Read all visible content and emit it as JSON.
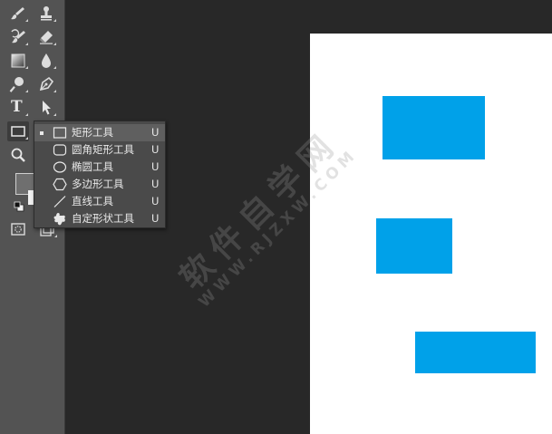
{
  "toolbar": {
    "tools": [
      {
        "id": "brush",
        "icon": "brush-icon"
      },
      {
        "id": "stamp",
        "icon": "stamp-icon"
      },
      {
        "id": "history-brush",
        "icon": "history-brush-icon"
      },
      {
        "id": "eraser",
        "icon": "eraser-icon"
      },
      {
        "id": "gradient",
        "icon": "gradient-icon"
      },
      {
        "id": "blur",
        "icon": "drop-icon"
      },
      {
        "id": "dodge",
        "icon": "dodge-icon"
      },
      {
        "id": "pen",
        "icon": "pen-icon"
      },
      {
        "id": "type",
        "icon": "type-icon",
        "glyph": "T"
      },
      {
        "id": "path-selection",
        "icon": "arrow-icon"
      },
      {
        "id": "rectangle",
        "icon": "rectangle-icon",
        "active": true
      },
      {
        "id": "zoom",
        "icon": "zoom-icon"
      },
      {
        "id": "quick-mask",
        "icon": "quick-mask-icon"
      },
      {
        "id": "screen-mode",
        "icon": "screen-mode-icon"
      }
    ],
    "colors": {
      "foreground": "#6f6f6f",
      "background": "#f2f2f2"
    }
  },
  "shape_menu": {
    "items": [
      {
        "label": "矩形工具",
        "shortcut": "U",
        "icon": "rectangle-icon",
        "selected": true
      },
      {
        "label": "圆角矩形工具",
        "shortcut": "U",
        "icon": "rounded-rectangle-icon"
      },
      {
        "label": "椭圆工具",
        "shortcut": "U",
        "icon": "ellipse-icon"
      },
      {
        "label": "多边形工具",
        "shortcut": "U",
        "icon": "polygon-icon"
      },
      {
        "label": "直线工具",
        "shortcut": "U",
        "icon": "line-icon"
      },
      {
        "label": "自定形状工具",
        "shortcut": "U",
        "icon": "custom-shape-icon"
      }
    ]
  },
  "canvas": {
    "background": "#ffffff",
    "shape_color": "#00a1e9"
  },
  "watermark": {
    "text": "软件自学网",
    "url": "WWW.RJZXW.COM"
  }
}
